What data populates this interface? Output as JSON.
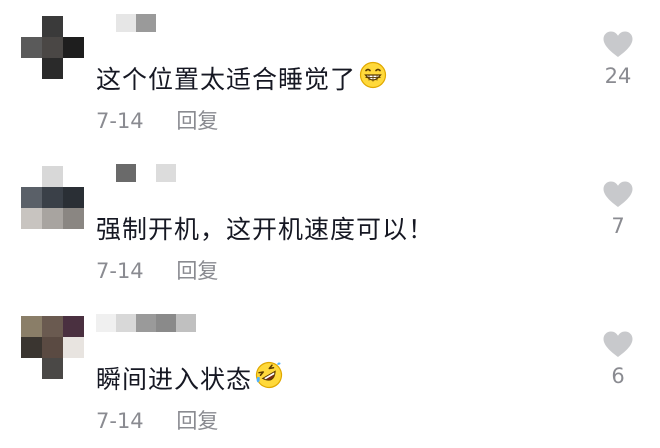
{
  "comments": [
    {
      "text": "这个位置太适合睡觉了",
      "emoji": "grinning-face-emoji",
      "date": "7-14",
      "reply_label": "回复",
      "likes": "24"
    },
    {
      "text": "强制开机，这开机速度可以！",
      "emoji": "",
      "date": "7-14",
      "reply_label": "回复",
      "likes": "7"
    },
    {
      "text": "瞬间进入状态",
      "emoji": "rolling-on-floor-laughing-emoji",
      "date": "7-14",
      "reply_label": "回复",
      "likes": "6"
    }
  ],
  "colors": {
    "text": "#161823",
    "meta": "#8a8b91",
    "heart": "#c8c9cc"
  }
}
